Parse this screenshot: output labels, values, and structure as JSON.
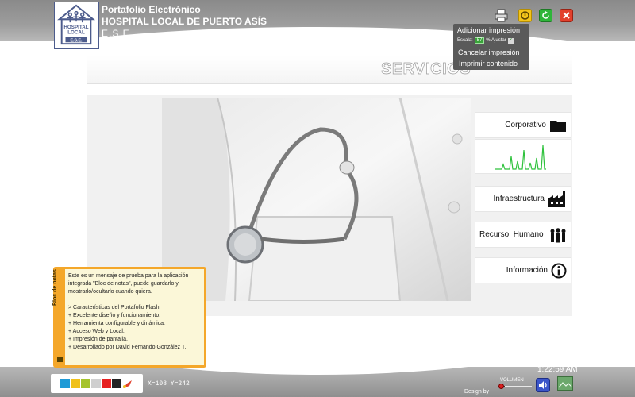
{
  "app": {
    "title_line1": "Portafolio Electrónico",
    "title_line2": "HOSPITAL LOCAL DE PUERTO ASÍS",
    "title_line3": "E.S.E.",
    "logo_text_top": "HOSPITAL",
    "logo_text_mid": "LOCAL",
    "logo_text_bottom": "E.S.E."
  },
  "header_buttons": {
    "print_icon": "printer-icon",
    "help_icon": "help-icon",
    "refresh_icon": "refresh-icon",
    "close_icon": "close-icon"
  },
  "print_menu": {
    "add_label": "Adicionar impresión",
    "scale_label": "Escala:",
    "scale_value": "57",
    "scale_suffix": "% Ajustar",
    "cancel_label": "Cancelar impresión",
    "print_label": "Imprimir contenido"
  },
  "section": {
    "title": "SERVICIOS"
  },
  "side_menu": {
    "items": [
      {
        "label": "Corporativo",
        "icon": "folder-icon"
      },
      {
        "label": "",
        "icon": "heartbeat-chart-icon"
      },
      {
        "label": "Infraestructura",
        "icon": "factory-icon"
      },
      {
        "label": "Recurso  Humano",
        "icon": "people-icon"
      },
      {
        "label": "Información",
        "icon": "info-icon"
      }
    ]
  },
  "notepad": {
    "tab_label": "Bloc de notas",
    "lines": [
      "Este es un mensaje de prueba para la aplicación",
      "integrada \"Bloc de notas\", puede guardarlo y",
      "mostrarlo/ocultarlo cuando quiera.",
      "",
      "> Características del Portafolio Flash",
      "+ Excelente diseño y funcionamiento.",
      "+ Herramienta configurable y dinámica.",
      "+ Acceso Web y Local.",
      "+ Impresión de pantalla.",
      "+ Desarrollado por David Fernando González T."
    ]
  },
  "footer": {
    "coordinates": "X=108 Y=242",
    "clock": "1:22:59 AM",
    "volume_label": "VOLUMEN",
    "design_by": "Design by",
    "swatch_colors": [
      "#1f9ad6",
      "#f0c11a",
      "#a5c32c",
      "#cfcfcf",
      "#e62020",
      "#222222"
    ]
  },
  "colors": {
    "header_gray": "#9d9d9d",
    "notepad_border": "#f4a72a",
    "menu_dark": "#5a5a5a",
    "help_yellow": "#f3c41b",
    "refresh_green": "#2fb53a",
    "close_red": "#e2402c"
  }
}
